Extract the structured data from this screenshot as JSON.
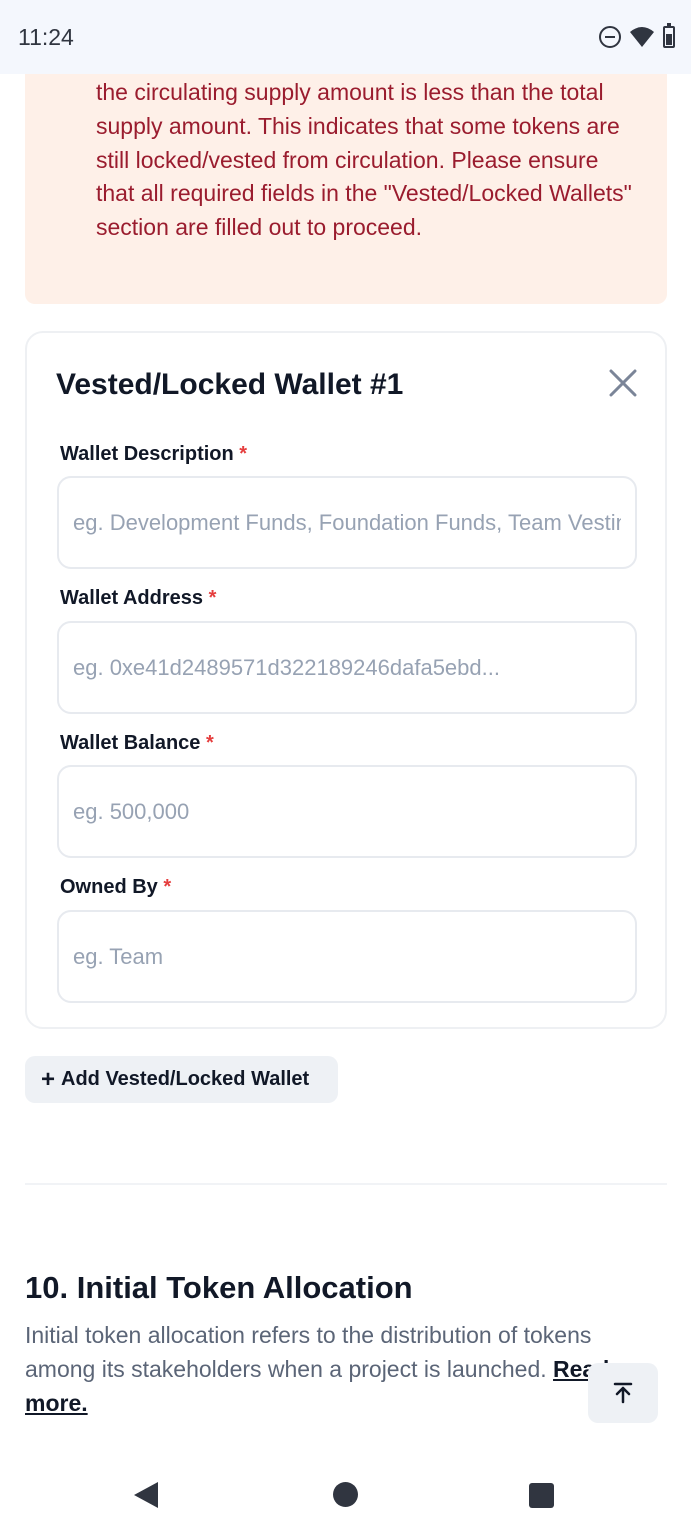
{
  "status_bar": {
    "time": "11:24"
  },
  "alert": {
    "text": "the circulating supply amount is less than the total supply amount. This indicates that some tokens are still locked/vested from circulation. Please ensure that all required fields in the \"Vested/Locked Wallets\" section are filled out to proceed."
  },
  "wallet_card": {
    "title": "Vested/Locked Wallet #1",
    "required_marker": "*",
    "fields": [
      {
        "label": "Wallet Description",
        "placeholder": "eg. Development Funds, Foundation Funds, Team Vesting",
        "value": ""
      },
      {
        "label": "Wallet Address",
        "placeholder": "eg. 0xe41d2489571d322189246dafa5ebd...",
        "value": ""
      },
      {
        "label": "Wallet Balance",
        "placeholder": "eg. 500,000",
        "value": ""
      },
      {
        "label": "Owned By",
        "placeholder": "eg. Team",
        "value": ""
      }
    ]
  },
  "add_wallet": {
    "plus": "+",
    "label": "Add Vested/Locked Wallet"
  },
  "section": {
    "title": "10. Initial Token Allocation",
    "description": "Initial token allocation refers to the distribution of tokens among its stakeholders when a project is launched. ",
    "read_more": "Read more."
  },
  "icons": {
    "close": "close-icon",
    "scroll_top": "arrow-up-to-line-icon",
    "status": [
      "do-not-disturb-icon",
      "wifi-icon",
      "battery-icon"
    ],
    "nav": [
      "back-icon",
      "home-icon",
      "recents-icon"
    ]
  },
  "colors": {
    "alert_bg": "#fef0e8",
    "alert_text": "#9a1c2e",
    "required": "#e53e3e",
    "placeholder": "#97a2b3"
  }
}
